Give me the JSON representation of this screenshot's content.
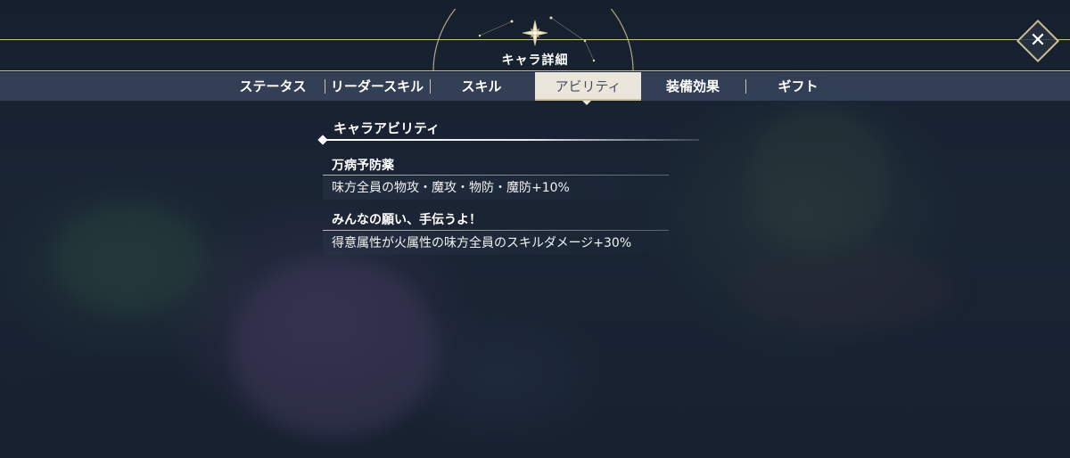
{
  "header": {
    "title": "キャラ詳細",
    "close_label": "✕"
  },
  "tabs": [
    {
      "label": "ステータス",
      "active": false
    },
    {
      "label": "リーダースキル",
      "active": false
    },
    {
      "label": "スキル",
      "active": false
    },
    {
      "label": "アビリティ",
      "active": true
    },
    {
      "label": "装備効果",
      "active": false
    },
    {
      "label": "ギフト",
      "active": false
    }
  ],
  "section": {
    "title": "キャラアビリティ"
  },
  "abilities": [
    {
      "name": "万病予防薬",
      "description": "味方全員の物攻・魔攻・物防・魔防+10%"
    },
    {
      "name": "みんなの願い、手伝うよ！",
      "description": "得意属性が火属性の味方全員のスキルダメージ+30%"
    }
  ],
  "colors": {
    "accent_gold": "#cdbf93",
    "tab_active_bg": "#eae6dc",
    "tab_bar_bg": "#3a4860"
  }
}
